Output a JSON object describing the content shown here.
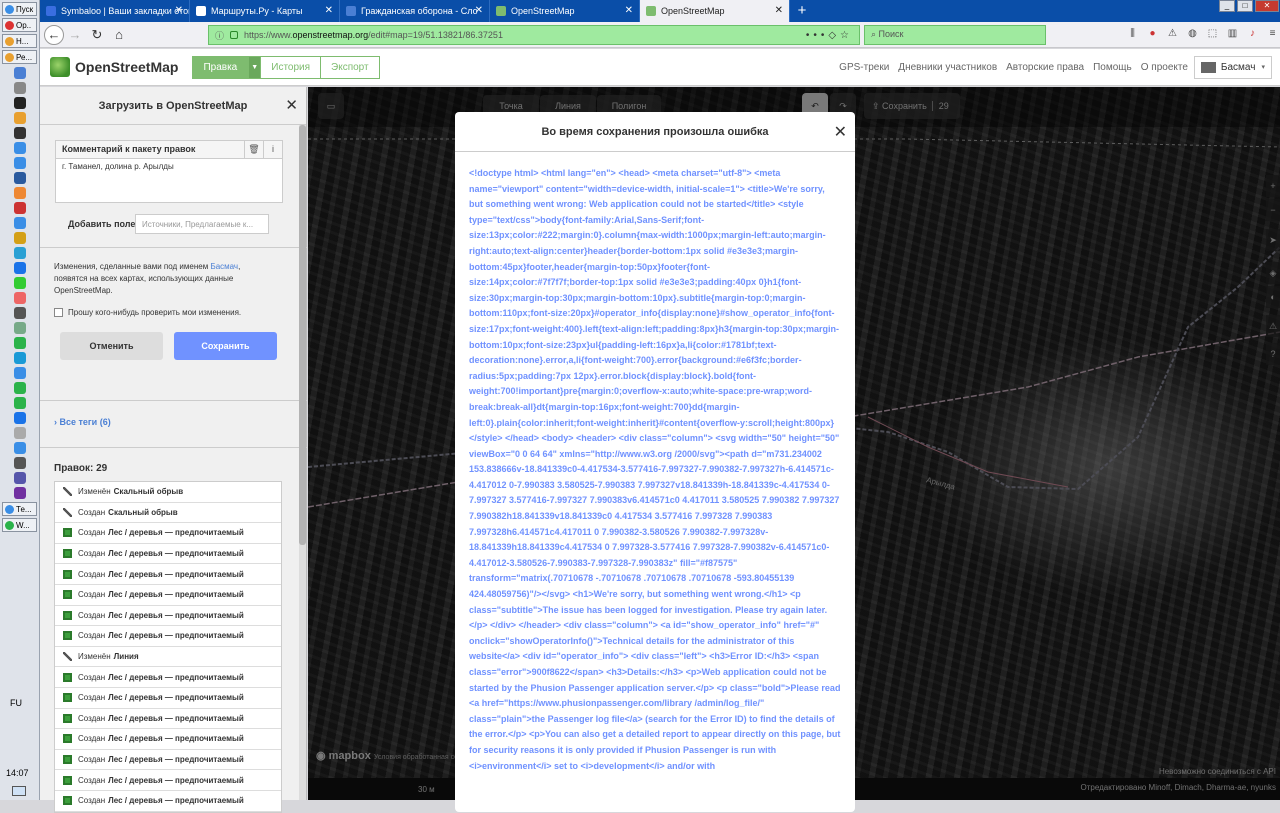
{
  "taskbar": {
    "start_label": "Пуск",
    "buttons": [
      {
        "label": "Ор..",
        "color": "#d33"
      },
      {
        "label": "Н...",
        "color": "#e8a030"
      },
      {
        "label": "Ре...",
        "color": "#e8a030"
      }
    ],
    "lower_buttons": [
      {
        "label": "Те...",
        "color": "#3a8ee6"
      },
      {
        "label": "W...",
        "color": "#2bb34a"
      }
    ],
    "icon_colors": [
      "#4a7fd4",
      "#888",
      "#222",
      "#e8a030",
      "#333",
      "#3a8ee6",
      "#3a8ee6",
      "#2a5a9e",
      "#e83",
      "#c33",
      "#3a8ee6",
      "#d4a017",
      "#2aa0d4",
      "#1a73e8",
      "#3c3",
      "#e66",
      "#555",
      "#7a8",
      "#2bb34a",
      "#1a9ad6",
      "#3a8ee6",
      "#2bb34a",
      "#2bb34a",
      "#1a73e8",
      "#aaa",
      "#3a8ee6",
      "#555",
      "#55a",
      "#7030a0"
    ],
    "lang": "FU",
    "clock": "14:07"
  },
  "tabs": [
    {
      "label": "Symbaloo | Ваши закладки отовсюду",
      "color": "#3a6ee0",
      "active": false
    },
    {
      "label": "Маршруты.Ру - Карты",
      "color": "#ffffff",
      "active": false
    },
    {
      "label": "Гражданская оборона - Сло",
      "color": "#4a7fd4",
      "active": false
    },
    {
      "label": "OpenStreetMap",
      "color": "#7ebc6f",
      "active": false
    },
    {
      "label": "OpenStreetMap",
      "color": "#7ebc6f",
      "active": true
    }
  ],
  "url": {
    "prefix": "https://www.",
    "domain": "openstreetmap.org",
    "path": "/edit#map=19/51.13821/86.37251"
  },
  "search_placeholder": "Поиск",
  "osm": {
    "title": "OpenStreetMap",
    "edit_label": "Правка",
    "history_label": "История",
    "export_label": "Экспорт",
    "links": [
      "GPS-треки",
      "Дневники участников",
      "Авторские права",
      "Помощь",
      "О проекте"
    ],
    "username": "Басмач"
  },
  "sidebar": {
    "title": "Загрузить в OpenStreetMap",
    "comment_header": "Комментарий к пакету правок",
    "comment_value": "г. Таманел, долина р. Арылды",
    "add_field_label": "Добавить поле:",
    "add_field_placeholder": "Источники, Предлагаемые к...",
    "notice_before": "Изменения, сделанные вами под именем",
    "notice_user": "Басмач",
    "notice_after": ", появятся на всех картах, использующих данные OpenStreetMap.",
    "review_label": "Прошу кого-нибудь проверить мои изменения.",
    "cancel_label": "Отменить",
    "save_label": "Сохранить",
    "all_tags": "Все теги (6)",
    "edits_title": "Правок: 29",
    "edits": [
      {
        "action": "Изменён",
        "name": "Скальный обрыв",
        "type": "mod"
      },
      {
        "action": "Создан",
        "name": "Скальный обрыв",
        "type": "mod"
      },
      {
        "action": "Создан",
        "name": "Лес / деревья — предпочитаемый",
        "type": "cr"
      },
      {
        "action": "Создан",
        "name": "Лес / деревья — предпочитаемый",
        "type": "cr"
      },
      {
        "action": "Создан",
        "name": "Лес / деревья — предпочитаемый",
        "type": "cr"
      },
      {
        "action": "Создан",
        "name": "Лес / деревья — предпочитаемый",
        "type": "cr"
      },
      {
        "action": "Создан",
        "name": "Лес / деревья — предпочитаемый",
        "type": "cr"
      },
      {
        "action": "Создан",
        "name": "Лес / деревья — предпочитаемый",
        "type": "cr"
      },
      {
        "action": "Изменён",
        "name": "Линия",
        "type": "mod"
      },
      {
        "action": "Создан",
        "name": "Лес / деревья — предпочитаемый",
        "type": "cr"
      },
      {
        "action": "Создан",
        "name": "Лес / деревья — предпочитаемый",
        "type": "cr"
      },
      {
        "action": "Создан",
        "name": "Лес / деревья — предпочитаемый",
        "type": "cr"
      },
      {
        "action": "Создан",
        "name": "Лес / деревья — предпочитаемый",
        "type": "cr"
      },
      {
        "action": "Создан",
        "name": "Лес / деревья — предпочитаемый",
        "type": "cr"
      },
      {
        "action": "Создан",
        "name": "Лес / деревья — предпочитаемый",
        "type": "cr"
      },
      {
        "action": "Создан",
        "name": "Лес / деревья — предпочитаемый",
        "type": "cr"
      }
    ]
  },
  "map": {
    "toolbar": [
      "Точка",
      "Линия",
      "Полигон"
    ],
    "save_label": "Сохранить",
    "save_count": "29",
    "mapbox": "mapbox",
    "attribution": "Условия обработанная серв.",
    "scale": "30 м",
    "warning": "Невозможно соединиться с API",
    "edited_by": "Отредактировано Minoff, Dimach, Dharma-ae, nyunks",
    "road_label": "Арылда"
  },
  "modal": {
    "title": "Во время сохранения произошла ошибка",
    "body": "<!doctype html> <html lang=\"en\"> <head> <meta charset=\"utf-8\"> <meta name=\"viewport\" content=\"width=device-width, initial-scale=1\"> <title>We're sorry, but something went wrong: Web application could not be started</title> <style type=\"text/css\">body{font-family:Arial,Sans-Serif;font-size:13px;color:#222;margin:0}.column{max-width:1000px;margin-left:auto;margin-right:auto;text-align:center}header{border-bottom:1px solid #e3e3e3;margin-bottom:45px}footer,header{margin-top:50px}footer{font-size:14px;color:#7f7f7f;border-top:1px solid #e3e3e3;padding:40px 0}h1{font-size:30px;margin-top:30px;margin-bottom:10px}.subtitle{margin-top:0;margin-bottom:110px;font-size:20px}#operator_info{display:none}#show_operator_info{font-size:17px;font-weight:400}.left{text-align:left;padding:8px}h3{margin-top:30px;margin-bottom:10px;font-size:23px}ul{padding-left:16px}a,li{color:#1781bf;text-decoration:none}.error,a,li{font-weight:700}.error{background:#e6f3fc;border-radius:5px;padding:7px 12px}.error.block{display:block}.bold{font-weight:700!important}pre{margin:0;overflow-x:auto;white-space:pre-wrap;word-break:break-all}dt{margin-top:16px;font-weight:700}dd{margin-left:0}.plain{color:inherit;font-weight:inherit}#content{overflow-y:scroll;height:800px}</style> </head> <body> <header> <div class=\"column\"> <svg width=\"50\" height=\"50\" viewBox=\"0 0 64 64\" xmlns=\"http://www.w3.org /2000/svg\"><path d=\"m731.234002 153.838666v-18.841339c0-4.417534-3.577416-7.997327-7.990382-7.997327h-6.414571c-4.417012 0-7.990383 3.580525-7.990383 7.997327v18.841339h-18.841339c-4.417534 0-7.997327 3.577416-7.997327 7.990383v6.414571c0 4.417011 3.580525 7.990382 7.997327 7.990382h18.841339v18.841339c0 4.417534 3.577416 7.997328 7.990383 7.997328h6.414571c4.417011 0 7.990382-3.580526 7.990382-7.997328v-18.841339h18.841339c4.417534 0 7.997328-3.577416 7.997328-7.990382v-6.414571c0-4.417012-3.580526-7.990383-7.997328-7.990383z\" fill=\"#f87575\" transform=\"matrix(.70710678 -.70710678 .70710678 .70710678 -593.80455139 424.48059756)\"/></svg> <h1>We're sorry, but something went wrong.</h1> <p class=\"subtitle\">The issue has been logged for investigation. Please try again later.</p> </div> </header> <div class=\"column\"> <a id=\"show_operator_info\" href=\"#\" onclick=\"showOperatorInfo()\">Technical details for the administrator of this website</a> <div id=\"operator_info\"> <div class=\"left\"> <h3>Error ID:</h3> <span class=\"error\">900f8622</span> <h3>Details:</h3> <p>Web application could not be started by the Phusion Passenger application server.</p> <p class=\"bold\">Please read <a href=\"https://www.phusionpassenger.com/library /admin/log_file/\" class=\"plain\">the Passenger log file</a> (search for the Error ID) to find the details of the error.</p> <p>You can also get a detailed report to appear directly on this page, but for security reasons it is only provided if Phusion Passenger is run with <i>environment</i> set to <i>development</i> and/or with"
  }
}
